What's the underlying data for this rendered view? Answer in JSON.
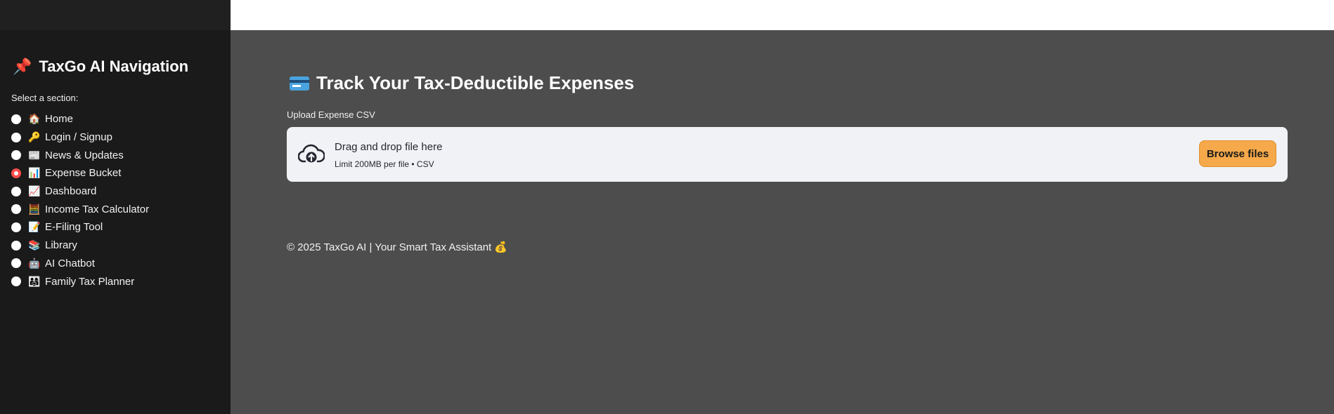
{
  "sidebar": {
    "title_emoji": "📌",
    "title": "TaxGo AI Navigation",
    "select_label": "Select a section:",
    "items": [
      {
        "emoji": "🏠",
        "label": "Home",
        "selected": false
      },
      {
        "emoji": "🔑",
        "label": "Login / Signup",
        "selected": false
      },
      {
        "emoji": "📰",
        "label": "News & Updates",
        "selected": false
      },
      {
        "emoji": "📊",
        "label": "Expense Bucket",
        "selected": true
      },
      {
        "emoji": "📈",
        "label": "Dashboard",
        "selected": false
      },
      {
        "emoji": "🧮",
        "label": "Income Tax Calculator",
        "selected": false
      },
      {
        "emoji": "📝",
        "label": "E-Filing Tool",
        "selected": false
      },
      {
        "emoji": "📚",
        "label": "Library",
        "selected": false
      },
      {
        "emoji": "🤖",
        "label": "AI Chatbot",
        "selected": false
      },
      {
        "emoji": "👨‍👩‍👧",
        "label": "Family Tax Planner",
        "selected": false
      }
    ]
  },
  "main": {
    "title": "Track Your Tax-Deductible Expenses",
    "upload_label": "Upload Expense CSV",
    "dropzone": {
      "title": "Drag and drop file here",
      "limit": "Limit 200MB per file • CSV",
      "button": "Browse files"
    },
    "footer": "© 2025 TaxGo AI | Your Smart Tax Assistant 💰"
  },
  "colors": {
    "sidebar_bg": "#1a1a1a",
    "main_bg": "#4d4d4d",
    "accent_radio": "#ff4b4b",
    "browse_button": "#f5a94a"
  }
}
